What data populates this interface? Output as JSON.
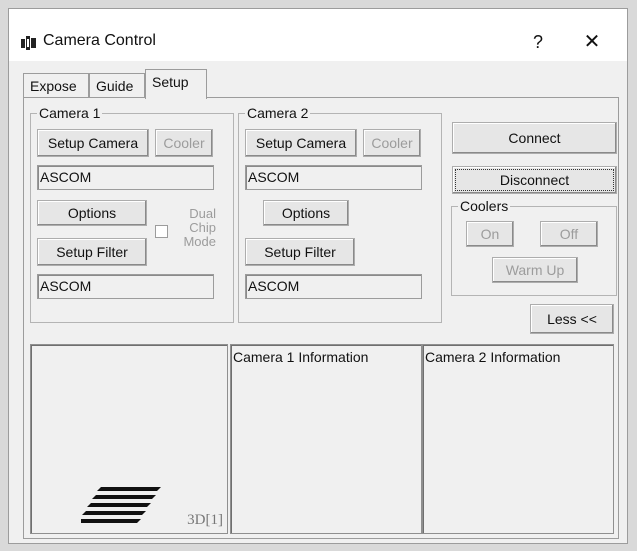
{
  "window": {
    "title": "Camera Control",
    "help_glyph": "?",
    "close_glyph": "✕"
  },
  "tabs": [
    {
      "label": "Expose"
    },
    {
      "label": "Guide"
    },
    {
      "label": "Setup",
      "active": true
    }
  ],
  "camera1": {
    "group_label": "Camera 1",
    "setup_camera": "Setup Camera",
    "cooler": "Cooler",
    "driver": "ASCOM",
    "options": "Options",
    "setup_filter": "Setup Filter",
    "filter_driver": "ASCOM",
    "dual_chip_label": [
      "Dual",
      "Chip",
      "Mode"
    ]
  },
  "camera2": {
    "group_label": "Camera 2",
    "setup_camera": "Setup Camera",
    "cooler": "Cooler",
    "driver": "ASCOM",
    "options": "Options",
    "setup_filter": "Setup Filter",
    "filter_driver": "ASCOM"
  },
  "connection": {
    "connect": "Connect",
    "disconnect": "Disconnect"
  },
  "coolers": {
    "group_label": "Coolers",
    "on": "On",
    "off": "Off",
    "warm_up": "Warm Up"
  },
  "less_button": "Less <<",
  "info": {
    "preview_label": "3D[1]",
    "camera1_title": "Camera 1 Information",
    "camera2_title": "Camera 2 Information"
  }
}
